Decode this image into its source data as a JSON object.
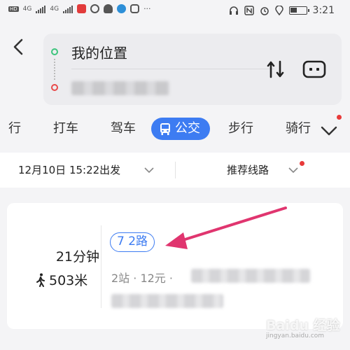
{
  "status_bar": {
    "network_left": [
      "HD",
      "4G",
      "4G"
    ],
    "time": "3:21",
    "overflow": "···"
  },
  "route": {
    "from": "我的位置",
    "to_blurred": true,
    "colors": {
      "start": "#3cc47c",
      "end": "#e84a4a"
    }
  },
  "tabs": [
    {
      "label": "行"
    },
    {
      "label": "打车"
    },
    {
      "label": "驾车"
    },
    {
      "label": "公交",
      "active": true
    },
    {
      "label": "步行"
    },
    {
      "label": "骑行"
    }
  ],
  "filter": {
    "departure": "12月10日 15:22出发",
    "sort": "推荐线路"
  },
  "result": {
    "duration": "21分钟",
    "walk_distance": "503米",
    "line_name": "7 2路",
    "line_info": "2站 · 12元 ·"
  },
  "watermark": {
    "brand": "Baidu 经验",
    "sub": "jingyan.baidu.com"
  },
  "accent_color": "#3d7cf2",
  "annotation_color": "#e0356f"
}
